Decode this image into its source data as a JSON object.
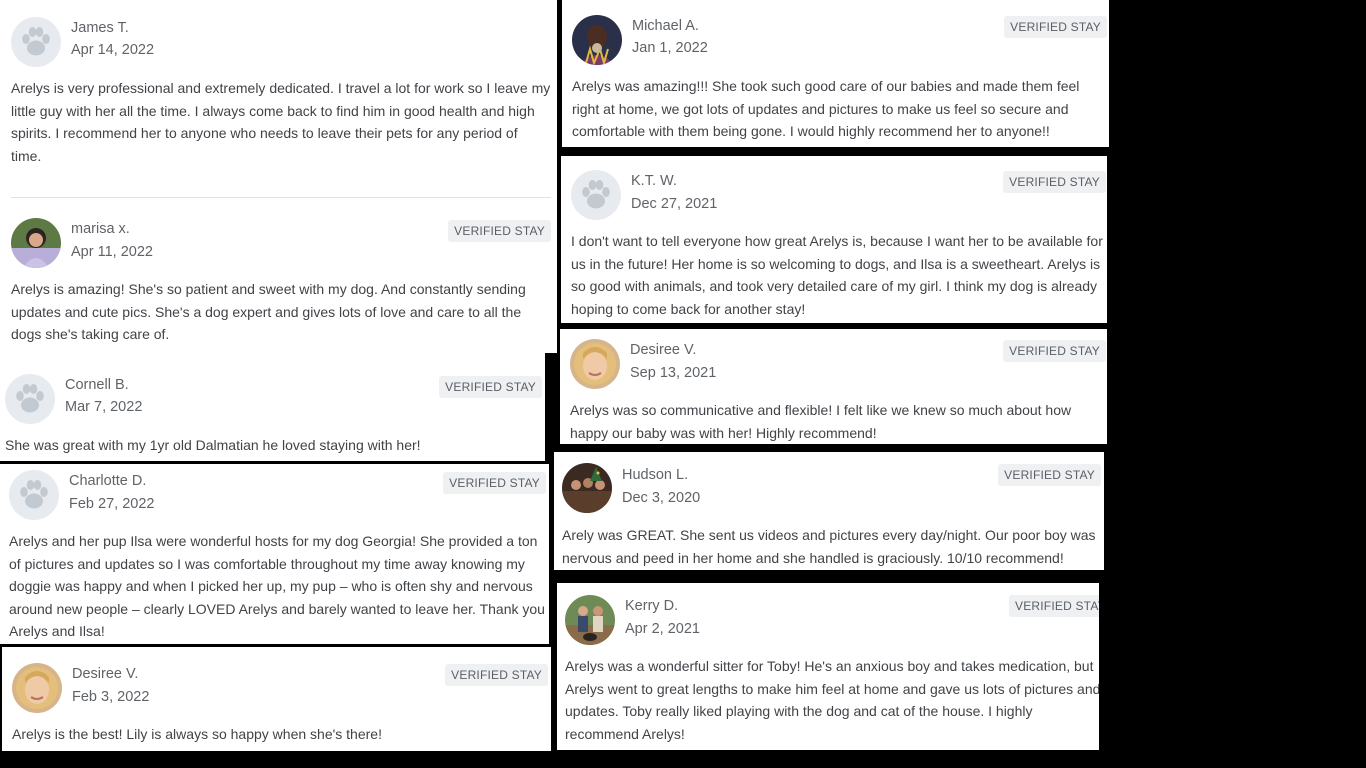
{
  "badge_label": "VERIFIED STAY",
  "reviews": [
    {
      "name": "James T.",
      "date": "Apr 14, 2022",
      "avatar": "paw-icon",
      "verified": false,
      "text": "Arelys is very professional and extremely dedicated. I travel a lot for work so I leave my little guy with her all the time. I always come back to find him in good health and high spirits. I recommend her to anyone who needs to leave their pets for any period of time."
    },
    {
      "name": "marisa x.",
      "date": "Apr 11, 2022",
      "avatar": "user-photo",
      "verified": true,
      "text": "Arelys is amazing! She's so patient and sweet with my dog. And constantly sending updates and cute pics. She's a dog expert and gives lots of love and care to all the dogs she's taking care of."
    },
    {
      "name": "Cornell B.",
      "date": "Mar 7, 2022",
      "avatar": "paw-icon",
      "verified": true,
      "text": "She was great with my 1yr old Dalmatian he loved staying with her!"
    },
    {
      "name": "Charlotte D.",
      "date": "Feb 27, 2022",
      "avatar": "paw-icon",
      "verified": true,
      "text": "Arelys and her pup Ilsa were wonderful hosts for my dog Georgia! She provided a ton of pictures and updates so I was comfortable throughout my time away knowing my doggie was happy and when I picked her up, my pup – who is often shy and nervous around new people – clearly LOVED Arelys and barely wanted to leave her. Thank you Arelys and Ilsa!"
    },
    {
      "name": "Desiree V.",
      "date": "Feb 3, 2022",
      "avatar": "user-photo",
      "verified": true,
      "text": "Arelys is the best! Lily is always so happy when she's there!"
    },
    {
      "name": "Michael A.",
      "date": "Jan 1, 2022",
      "avatar": "user-photo",
      "verified": true,
      "text": "Arelys was amazing!!! She took such good care of our babies and made them feel right at home, we got lots of updates and pictures to make us feel so secure and comfortable with them being gone. I would highly recommend her to anyone!!"
    },
    {
      "name": "K.T. W.",
      "date": "Dec 27, 2021",
      "avatar": "paw-icon",
      "verified": true,
      "text": "I don't want to tell everyone how great Arelys is, because I want her to be available for us in the future! Her home is so welcoming to dogs, and Ilsa is a sweetheart. Arelys is so good with animals, and took very detailed care of my girl. I think my dog is already hoping to come back for another stay!"
    },
    {
      "name": "Desiree V.",
      "date": "Sep 13, 2021",
      "avatar": "user-photo",
      "verified": true,
      "text": "Arelys was so communicative and flexible! I felt like we knew so much about how happy our baby was with her! Highly recommend!"
    },
    {
      "name": "Hudson L.",
      "date": "Dec 3, 2020",
      "avatar": "user-photo",
      "verified": true,
      "text": "Arely was GREAT. She sent us videos and pictures every day/night. Our poor boy was nervous and peed in her home and she handled is graciously. 10/10 recommend!"
    },
    {
      "name": "Kerry D.",
      "date": "Apr 2, 2021",
      "avatar": "user-photo",
      "verified": true,
      "text": "Arelys was a wonderful sitter for Toby! He's an anxious boy and takes medication, but Arelys went to great lengths to make him feel at home and gave us lots of pictures and updates. Toby really liked playing with the dog and cat of the house. I highly recommend Arelys!"
    }
  ]
}
